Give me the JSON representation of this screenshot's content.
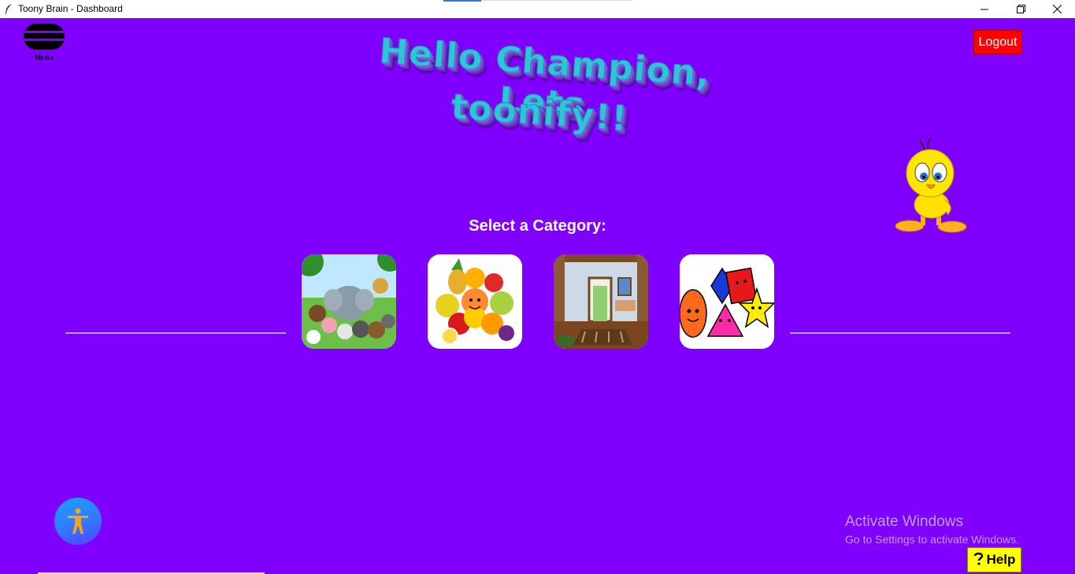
{
  "window": {
    "title": "Toony Brain - Dashboard",
    "icon": "feather-icon",
    "controls": [
      "minimize-icon",
      "restore-icon",
      "close-icon"
    ]
  },
  "menu": {
    "label": "Menu",
    "icon": "hamburger-icon"
  },
  "logout": {
    "label": "Logout",
    "color": "#ff0000"
  },
  "banner": {
    "line1": "Hello Champion, Lets",
    "line2": "toonify!!"
  },
  "mascot": "tweety-bird",
  "categories": {
    "heading": "Select a Category:",
    "items": [
      {
        "name": "animals",
        "image": "cartoon-animals"
      },
      {
        "name": "fruits",
        "image": "cartoon-fruits"
      },
      {
        "name": "house",
        "image": "cartoon-room"
      },
      {
        "name": "shapes",
        "image": "cartoon-shapes"
      }
    ]
  },
  "accessibility": {
    "icon": "accessibility-icon"
  },
  "watermark": {
    "line1": "Activate Windows",
    "line2": "Go to Settings to activate Windows."
  },
  "help": {
    "label": "Help",
    "icon": "question-icon",
    "color": "#ffff00"
  },
  "colors": {
    "background": "#8000ff",
    "accent": "#2fc4d8"
  }
}
